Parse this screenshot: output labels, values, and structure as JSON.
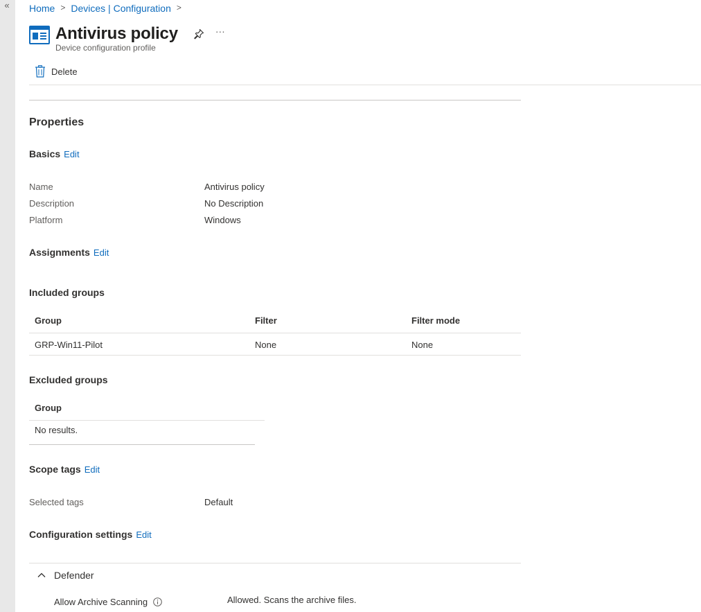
{
  "rail": {
    "collapse_glyph": "«"
  },
  "breadcrumb": {
    "items": [
      "Home",
      "Devices | Configuration"
    ],
    "separator": ">"
  },
  "header": {
    "title": "Antivirus policy",
    "subtitle": "Device configuration profile",
    "icons": [
      "policy-profile-icon",
      "pin-icon",
      "more-icon"
    ],
    "more_glyph": "···"
  },
  "toolbar": {
    "delete_label": "Delete"
  },
  "properties": {
    "heading": "Properties",
    "basics": {
      "heading": "Basics",
      "edit_label": "Edit",
      "rows": [
        {
          "label": "Name",
          "value": "Antivirus policy"
        },
        {
          "label": "Description",
          "value": "No Description"
        },
        {
          "label": "Platform",
          "value": "Windows"
        }
      ]
    },
    "assignments": {
      "heading": "Assignments",
      "edit_label": "Edit"
    },
    "included_groups": {
      "heading": "Included groups",
      "columns": [
        "Group",
        "Filter",
        "Filter mode"
      ],
      "rows": [
        {
          "group": "GRP-Win11-Pilot",
          "filter": "None",
          "filter_mode": "None"
        }
      ]
    },
    "excluded_groups": {
      "heading": "Excluded groups",
      "columns": [
        "Group"
      ],
      "empty_text": "No results."
    },
    "scope_tags": {
      "heading": "Scope tags",
      "edit_label": "Edit",
      "rows": [
        {
          "label": "Selected tags",
          "value": "Default"
        }
      ]
    },
    "configuration_settings": {
      "heading": "Configuration settings",
      "edit_label": "Edit",
      "sections": [
        {
          "title": "Defender",
          "expanded": true,
          "settings": [
            {
              "label": "Allow Archive Scanning",
              "value": "Allowed. Scans the archive files."
            }
          ]
        }
      ]
    }
  },
  "colors": {
    "link": "#0f6cbd",
    "text": "#323130",
    "secondary_text": "#605e5c",
    "rail": "#e8e8e8",
    "divider": "#e1dfdd"
  }
}
